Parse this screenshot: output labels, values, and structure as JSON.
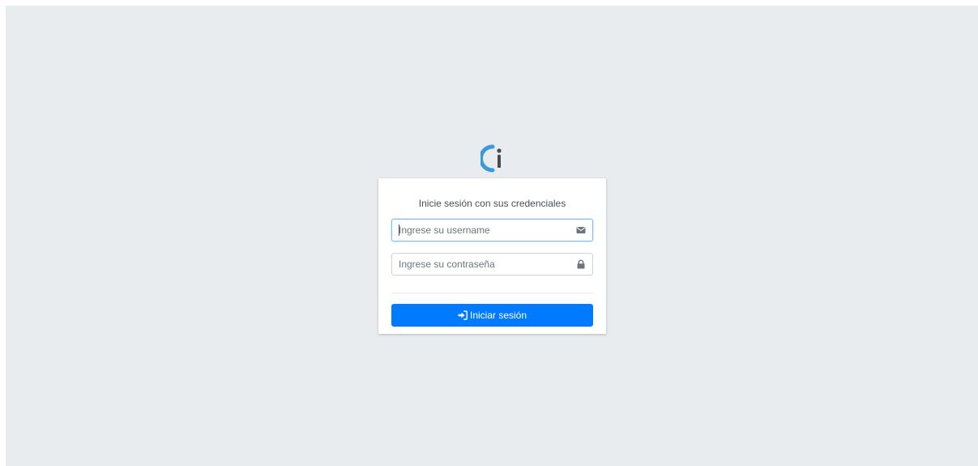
{
  "login": {
    "message": "Inicie sesión con sus credenciales",
    "username": {
      "placeholder": "Ingrese su username",
      "value": "",
      "icon": "envelope-icon"
    },
    "password": {
      "placeholder": "Ingrese su contraseña",
      "value": "",
      "icon": "lock-icon"
    },
    "submit": {
      "label": "Iniciar sesión",
      "icon": "sign-in-icon"
    }
  },
  "colors": {
    "page_background": "#e9ecef",
    "card_background": "#ffffff",
    "primary": "#007bff",
    "logo_blue": "#3b9ad9",
    "logo_gray": "#4a4a4a",
    "focus_border": "#80bdff",
    "icon_gray": "#6c757d"
  }
}
